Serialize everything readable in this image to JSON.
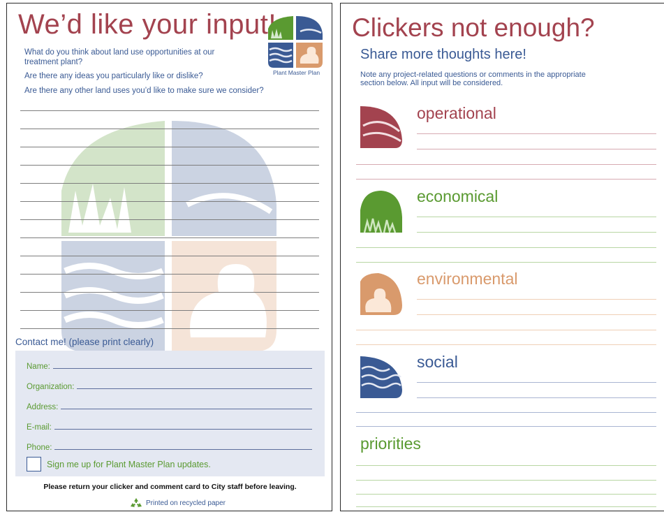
{
  "left_card": {
    "title": "We’d like your input!",
    "questions": [
      "What do you think about land use opportunities at our treatment plant?",
      "Are there any ideas you particularly like or dislike?",
      "Are there any other land uses you’d like to make sure we consider?"
    ],
    "logo_caption": "Plant Master Plan",
    "contact_title": "Contact me! (please print clearly)",
    "contact_fields": [
      "Name:",
      "Organization:",
      "Address:",
      "E-mail:",
      "Phone:"
    ],
    "signup_label": "Sign me up for Plant Master Plan updates.",
    "return_note": "Please return your clicker and comment card to City staff before leaving.",
    "recycled_note": "Printed on recycled paper"
  },
  "right_card": {
    "title": "Clickers not enough?",
    "subtitle": "Share more thoughts here!",
    "note": "Note any project-related questions or comments in the appropriate section below. All input will be considered.",
    "sections": [
      {
        "heading": "operational",
        "color": "#a3434f",
        "line_color": "#d7aab2",
        "icon": "plant-tank-icon"
      },
      {
        "heading": "economical",
        "color": "#5a9a31",
        "line_color": "#b8d6a3",
        "icon": "grass-field-icon"
      },
      {
        "heading": "environmental",
        "color": "#d99a6c",
        "line_color": "#efcfb6",
        "icon": "duck-icon"
      },
      {
        "heading": "social",
        "color": "#3a5a94",
        "line_color": "#a9b5d2",
        "icon": "water-waves-icon"
      },
      {
        "heading": "priorities",
        "color": "#5a9a31",
        "line_color": "#b8d6a3",
        "icon": ""
      }
    ]
  },
  "colors": {
    "brand_red": "#a3434f",
    "brand_blue": "#3a5a94",
    "brand_green": "#5a9a31",
    "brand_tan": "#d99a6c",
    "contact_panel": "#e4e8f2"
  }
}
